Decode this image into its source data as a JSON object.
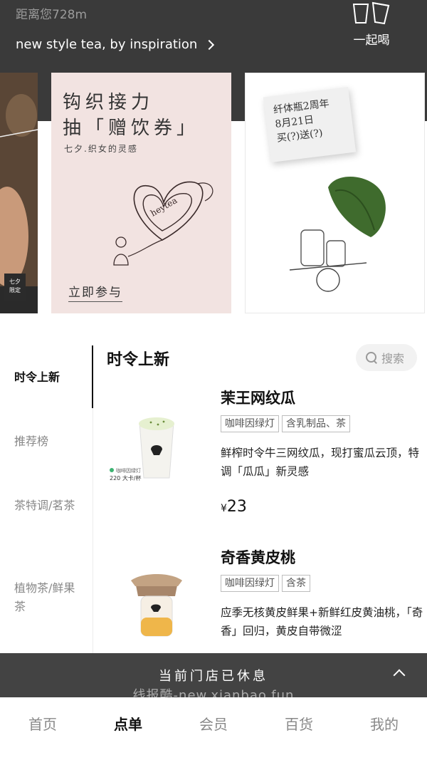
{
  "header": {
    "distance": "距离您728m",
    "slogan": "new style tea, by inspiration",
    "together_label": "一起喝"
  },
  "banners": {
    "left_badge": "七夕\n限定",
    "mid": {
      "headline_1": "钩织接力",
      "headline_2": "抽「赠饮券」",
      "subtitle": "七夕.织女的灵感",
      "heart_text": "heytea",
      "cta": "立即参与"
    },
    "right": {
      "note_line1": "纤体瓶2周年",
      "note_line2": "8月21日",
      "note_line3": "买(?)送(?)"
    }
  },
  "categories": [
    {
      "label": "时令上新",
      "active": true
    },
    {
      "label": "推荐榜",
      "active": false
    },
    {
      "label": "茶特调/茗茶",
      "active": false
    },
    {
      "label": "植物茶/鲜果茶",
      "active": false
    }
  ],
  "section_title": "时令上新",
  "search": {
    "label": "搜索"
  },
  "products": [
    {
      "name": "茉王网纹瓜",
      "tags": [
        "咖啡因绿灯",
        "含乳制品、茶"
      ],
      "desc": "鲜榨时令牛三网纹瓜，现打蜜瓜云顶，特调「瓜瓜」新灵感",
      "currency": "¥",
      "price": "23",
      "image_caption": "咖啡因绿灯",
      "image_kcal": "220 大卡/杯"
    },
    {
      "name": "奇香黄皮桃",
      "tags": [
        "咖啡因绿灯",
        "含茶"
      ],
      "desc": "应季无核黄皮鲜果+新鲜红皮黄油桃，「奇香」回归，黄皮自带微涩"
    }
  ],
  "closed_bar": {
    "text": "当前门店已休息"
  },
  "watermark": "线报酷-new.xianbao.fun",
  "tabbar": [
    {
      "label": "首页",
      "active": false
    },
    {
      "label": "点单",
      "active": true
    },
    {
      "label": "会员",
      "active": false
    },
    {
      "label": "百货",
      "active": false
    },
    {
      "label": "我的",
      "active": false
    }
  ],
  "colors": {
    "header_bg": "#3a3a3a",
    "banner_pink": "#f2e3e1",
    "closed_bar_bg": "#434343",
    "accent_green": "#3cb371"
  }
}
